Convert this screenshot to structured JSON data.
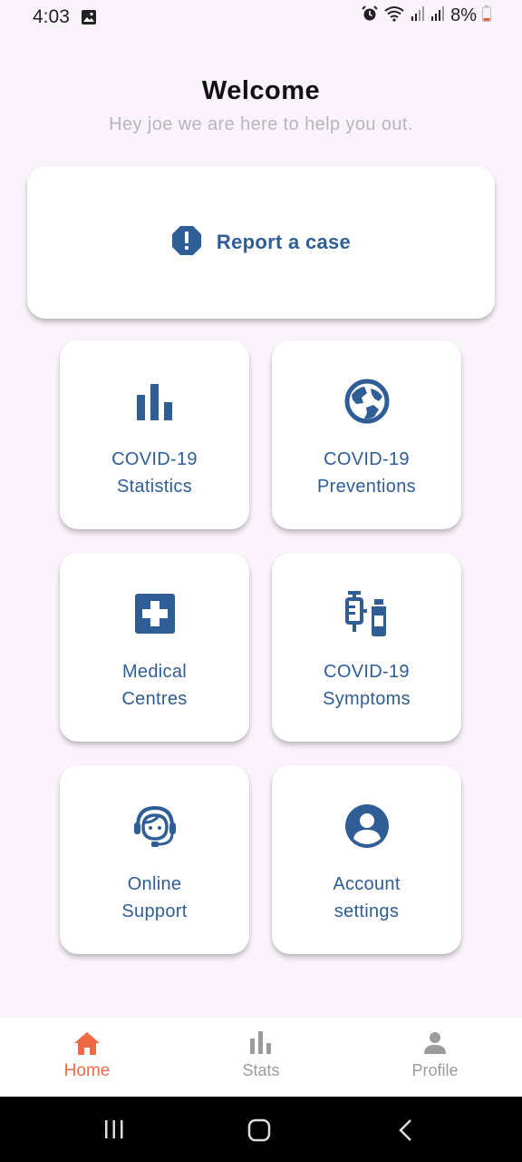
{
  "status_bar": {
    "time": "4:03",
    "battery": "8%",
    "icons": [
      "image-icon",
      "alarm-icon",
      "wifi-icon",
      "signal-icon",
      "signal-icon",
      "battery-icon"
    ]
  },
  "header": {
    "title": "Welcome",
    "subtitle": "Hey joe we are here to help you out."
  },
  "report_card": {
    "label": "Report a case",
    "icon": "alert-octagon-icon"
  },
  "tiles": [
    {
      "line1": "COVID-19",
      "line2": "Statistics",
      "icon": "bar-chart-icon"
    },
    {
      "line1": "COVID-19",
      "line2": "Preventions",
      "icon": "globe-icon"
    },
    {
      "line1": "Medical",
      "line2": "Centres",
      "icon": "medical-cross-icon"
    },
    {
      "line1": "COVID-19",
      "line2": "Symptoms",
      "icon": "vaccine-icon"
    },
    {
      "line1": "Online",
      "line2": "Support",
      "icon": "support-agent-icon"
    },
    {
      "line1": "Account",
      "line2": "settings",
      "icon": "account-circle-icon"
    }
  ],
  "bottom_nav": {
    "items": [
      {
        "label": "Home",
        "icon": "home-icon",
        "active": true
      },
      {
        "label": "Stats",
        "icon": "bar-chart-icon",
        "active": false
      },
      {
        "label": "Profile",
        "icon": "person-icon",
        "active": false
      }
    ]
  },
  "colors": {
    "primary": "#2f5d95",
    "accent": "#ef6a45",
    "background": "#fbf3fb",
    "inactive": "#9b9b9b"
  }
}
